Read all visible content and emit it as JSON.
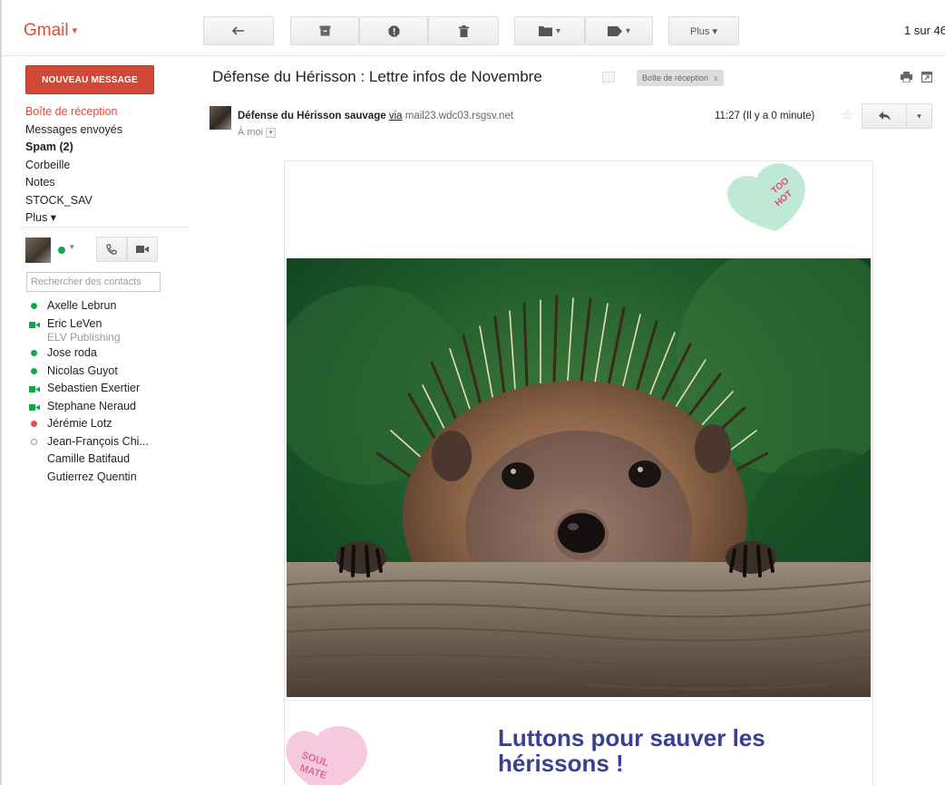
{
  "app": {
    "logo": "Gmail",
    "logo_caret": "▾"
  },
  "toolbar": {
    "more_label": "Plus ▾",
    "pager": "1 sur 46"
  },
  "sidebar": {
    "compose_label": "NOUVEAU MESSAGE",
    "folders": [
      {
        "label": "Boîte de réception",
        "active": true
      },
      {
        "label": "Messages envoyés"
      },
      {
        "label": "Spam (2)",
        "bold": true
      },
      {
        "label": "Corbeille"
      },
      {
        "label": "Notes"
      },
      {
        "label": "STOCK_SAV"
      },
      {
        "label": "Plus ▾"
      }
    ],
    "contacts_search_placeholder": "Rechercher des contacts",
    "contacts": [
      {
        "name": "Axelle Lebrun",
        "status": "online"
      },
      {
        "name": "Eric LeVen",
        "sub": "ELV Publishing",
        "status": "video"
      },
      {
        "name": "Jose roda",
        "status": "online"
      },
      {
        "name": "Nicolas Guyot",
        "status": "online"
      },
      {
        "name": "Sebastien Exertier",
        "status": "video"
      },
      {
        "name": "Stephane Neraud",
        "status": "video"
      },
      {
        "name": "Jérémie Lotz",
        "status": "busy"
      },
      {
        "name": "Jean-François Chi...",
        "status": "idle"
      },
      {
        "name": "Camille Batifaud",
        "status": "none"
      },
      {
        "name": "Gutierrez Quentin",
        "status": "none"
      }
    ]
  },
  "message": {
    "subject": "Défense du Hérisson : Lettre infos de Novembre",
    "label": "Boîte de réception",
    "label_close": "x",
    "sender_name": "Défense du Hérisson sauvage",
    "via": "via",
    "sender_domain": "mail23.wdc03.rsgsv.net",
    "to": "À moi",
    "time": "11:27 (Il y a 0 minute)",
    "star": "☆"
  },
  "email": {
    "headline": "Luttons pour sauver les hérissons !",
    "heart_top_text_1": "TOO",
    "heart_top_text_2": "HOT",
    "heart_bottom_text_1": "SOUL",
    "heart_bottom_text_2": "MATE"
  },
  "colors": {
    "brand_red": "#dd4b39",
    "compose": "#d14836",
    "headline": "#3a3f95",
    "online": "#1aa34a"
  }
}
